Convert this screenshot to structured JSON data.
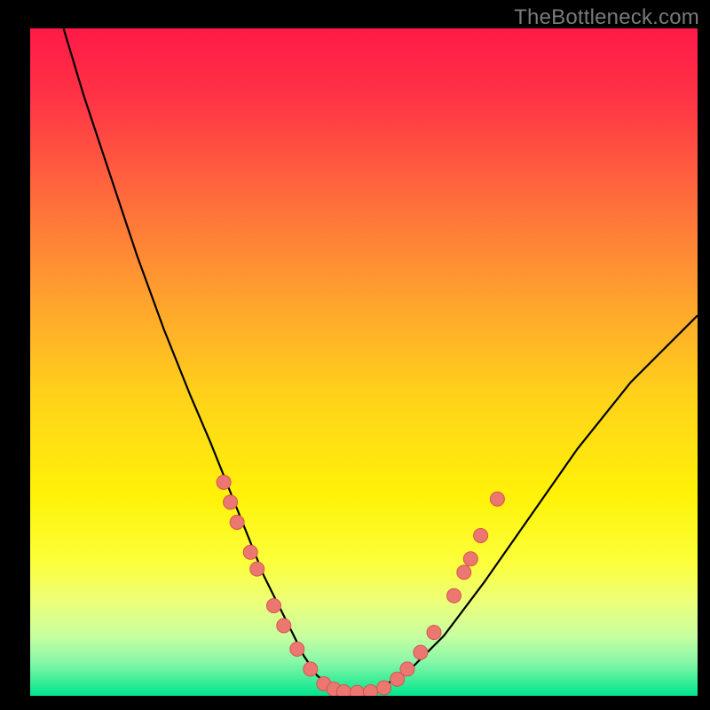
{
  "watermark": "TheBottleneck.com",
  "colors": {
    "frame": "#000000",
    "curve": "#000000",
    "marker_fill": "#ec7770",
    "marker_stroke": "#d3564f",
    "gradient_stops": [
      {
        "offset": 0.0,
        "color": "#ff1a47"
      },
      {
        "offset": 0.1,
        "color": "#ff3246"
      },
      {
        "offset": 0.25,
        "color": "#ff6a3c"
      },
      {
        "offset": 0.4,
        "color": "#ffa02f"
      },
      {
        "offset": 0.55,
        "color": "#ffd21a"
      },
      {
        "offset": 0.7,
        "color": "#fff208"
      },
      {
        "offset": 0.8,
        "color": "#fcff3a"
      },
      {
        "offset": 0.86,
        "color": "#ecff7a"
      },
      {
        "offset": 0.91,
        "color": "#c8ffa0"
      },
      {
        "offset": 0.95,
        "color": "#86f7a8"
      },
      {
        "offset": 1.0,
        "color": "#00e58c"
      }
    ]
  },
  "chart_data": {
    "type": "line",
    "title": "",
    "xlabel": "",
    "ylabel": "",
    "xlim": [
      0,
      100
    ],
    "ylim": [
      0,
      100
    ],
    "series": [
      {
        "name": "bottleneck-curve",
        "x": [
          5,
          8,
          12,
          16,
          20,
          24,
          27,
          29,
          31,
          33,
          35,
          37,
          39,
          41,
          43,
          45,
          48,
          50,
          53,
          57,
          62,
          68,
          75,
          82,
          90,
          100
        ],
        "y": [
          100,
          90,
          78,
          66,
          55,
          45,
          38,
          33,
          28,
          23,
          18,
          14,
          10,
          6,
          3,
          1.5,
          0.5,
          0.5,
          1.5,
          4,
          9,
          17,
          27,
          37,
          47,
          57
        ]
      }
    ],
    "markers": [
      {
        "x": 29.0,
        "y": 32.0
      },
      {
        "x": 30.0,
        "y": 29.0
      },
      {
        "x": 31.0,
        "y": 26.0
      },
      {
        "x": 33.0,
        "y": 21.5
      },
      {
        "x": 34.0,
        "y": 19.0
      },
      {
        "x": 36.5,
        "y": 13.5
      },
      {
        "x": 38.0,
        "y": 10.5
      },
      {
        "x": 40.0,
        "y": 7.0
      },
      {
        "x": 42.0,
        "y": 4.0
      },
      {
        "x": 44.0,
        "y": 1.8
      },
      {
        "x": 45.5,
        "y": 1.0
      },
      {
        "x": 47.0,
        "y": 0.6
      },
      {
        "x": 49.0,
        "y": 0.5
      },
      {
        "x": 51.0,
        "y": 0.6
      },
      {
        "x": 53.0,
        "y": 1.2
      },
      {
        "x": 55.0,
        "y": 2.5
      },
      {
        "x": 56.5,
        "y": 4.0
      },
      {
        "x": 58.5,
        "y": 6.5
      },
      {
        "x": 60.5,
        "y": 9.5
      },
      {
        "x": 63.5,
        "y": 15.0
      },
      {
        "x": 65.0,
        "y": 18.5
      },
      {
        "x": 66.0,
        "y": 20.5
      },
      {
        "x": 67.5,
        "y": 24.0
      },
      {
        "x": 70.0,
        "y": 29.5
      }
    ]
  }
}
